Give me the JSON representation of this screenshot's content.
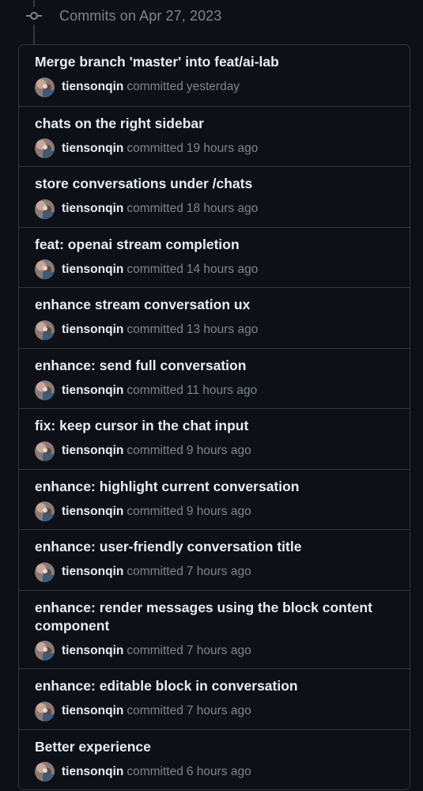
{
  "header": {
    "title": "Commits on Apr 27, 2023",
    "icon": "git-commit-icon"
  },
  "commit_text": {
    "verb": "committed"
  },
  "colors": {
    "background": "#0d1117",
    "border": "#30363d",
    "text_primary": "#e6edf3",
    "text_muted": "#7d8590"
  },
  "commits": [
    {
      "title": "Merge branch 'master' into feat/ai-lab",
      "author": "tiensonqin",
      "when": "yesterday"
    },
    {
      "title": "chats on the right sidebar",
      "author": "tiensonqin",
      "when": "19 hours ago"
    },
    {
      "title": "store conversations under /chats",
      "author": "tiensonqin",
      "when": "18 hours ago"
    },
    {
      "title": "feat: openai stream completion",
      "author": "tiensonqin",
      "when": "14 hours ago"
    },
    {
      "title": "enhance stream conversation ux",
      "author": "tiensonqin",
      "when": "13 hours ago"
    },
    {
      "title": "enhance: send full conversation",
      "author": "tiensonqin",
      "when": "11 hours ago"
    },
    {
      "title": "fix: keep cursor in the chat input",
      "author": "tiensonqin",
      "when": "9 hours ago"
    },
    {
      "title": "enhance: highlight current conversation",
      "author": "tiensonqin",
      "when": "9 hours ago"
    },
    {
      "title": "enhance: user-friendly conversation title",
      "author": "tiensonqin",
      "when": "7 hours ago"
    },
    {
      "title": "enhance: render messages using the block content component",
      "author": "tiensonqin",
      "when": "7 hours ago"
    },
    {
      "title": "enhance: editable block in conversation",
      "author": "tiensonqin",
      "when": "7 hours ago"
    },
    {
      "title": "Better experience",
      "author": "tiensonqin",
      "when": "6 hours ago"
    }
  ]
}
